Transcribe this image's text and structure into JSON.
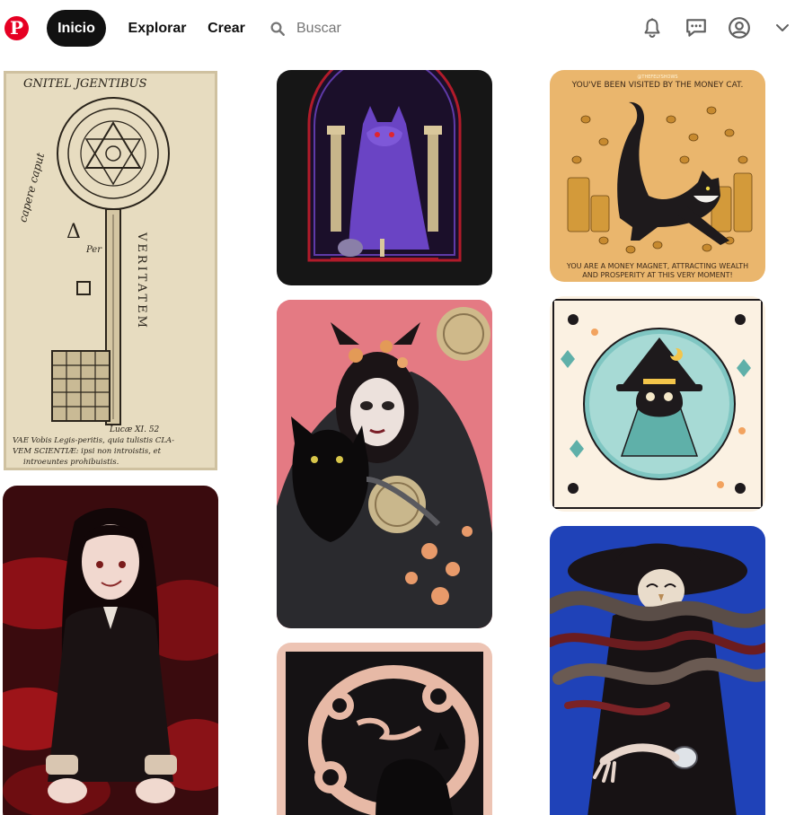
{
  "header": {
    "logo_letter": "P",
    "nav": {
      "home": "Inicio",
      "explore": "Explorar",
      "create": "Crear"
    },
    "search_placeholder": "Buscar",
    "icons": [
      "pinterest-logo-icon",
      "search-icon",
      "bell-icon",
      "chat-icon",
      "profile-icon",
      "chevron-down-icon"
    ]
  },
  "pins": {
    "manuscript": {
      "header_text": "GNITEL JGENTIBUS",
      "side_text_left": "capere caput",
      "side_text_right": "VERITATEM",
      "footer_1": "Lucæ XI. 52",
      "footer_2": "VAE Vobis Legis-peritis, quia tulistis CLA-",
      "footer_3": "VEM SCIENTIÆ: ipsi non introistis, et",
      "footer_4": "introeuntes prohibuistis."
    },
    "money_cat": {
      "credit": "@THEFELYSHOWS",
      "title": "YOU'VE BEEN VISITED BY THE MONEY CAT.",
      "caption_1": "YOU ARE A MONEY MAGNET, ATTRACTING WEALTH",
      "caption_2": "AND PROSPERITY AT THIS VERY MOMENT!"
    }
  },
  "colors": {
    "brand": "#e60023",
    "active_nav_bg": "#111111",
    "icon": "#5f5f5f"
  }
}
